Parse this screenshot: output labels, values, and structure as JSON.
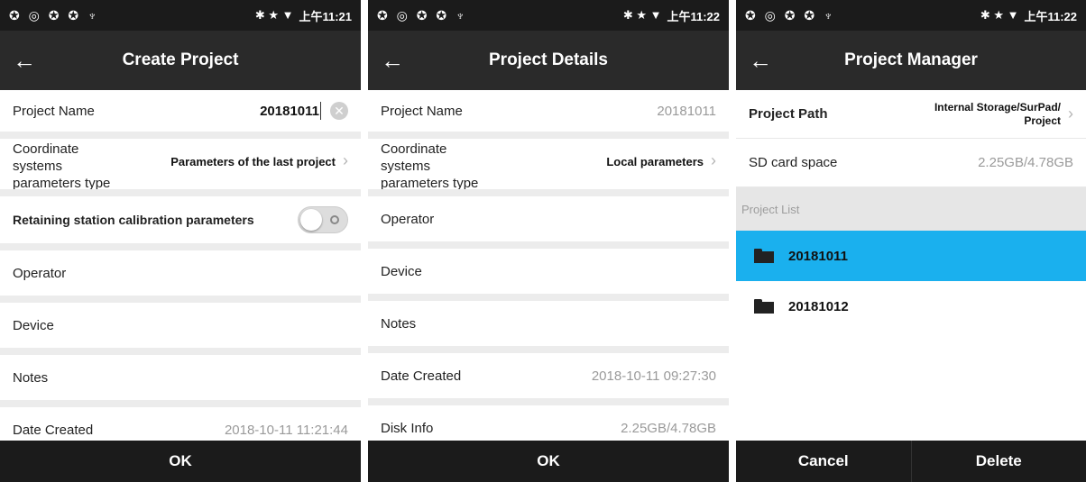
{
  "status": {
    "left_icons": "✪ ◎ ✪ ✪ ♆",
    "right_icons": "✱ ★ ▼",
    "panels_time": [
      "上午11:21",
      "上午11:22",
      "上午11:22"
    ]
  },
  "create_project": {
    "title": "Create Project",
    "project_name_label": "Project Name",
    "project_name_value": "20181011",
    "coord_label": "Coordinate systems parameters type",
    "coord_value": "Parameters of the last project",
    "retain_label": "Retaining station calibration parameters",
    "operator_label": "Operator",
    "device_label": "Device",
    "notes_label": "Notes",
    "date_label": "Date Created",
    "date_value": "2018-10-11 11:21:44",
    "ok_label": "OK"
  },
  "project_details": {
    "title": "Project Details",
    "project_name_label": "Project Name",
    "project_name_value": "20181011",
    "coord_label": "Coordinate systems parameters type",
    "coord_value": "Local parameters",
    "operator_label": "Operator",
    "device_label": "Device",
    "notes_label": "Notes",
    "date_label": "Date Created",
    "date_value": "2018-10-11 09:27:30",
    "disk_label": "Disk Info",
    "disk_value": "2.25GB/4.78GB",
    "ok_label": "OK"
  },
  "project_manager": {
    "title": "Project Manager",
    "path_label": "Project Path",
    "path_value_line1": "Internal Storage/SurPad/",
    "path_value_line2": "Project",
    "sd_label": "SD card space",
    "sd_value": "2.25GB/4.78GB",
    "list_header": "Project List",
    "projects": [
      "20181011",
      "20181012"
    ],
    "selected_color": "#1ab0ee",
    "cancel_label": "Cancel",
    "delete_label": "Delete"
  }
}
